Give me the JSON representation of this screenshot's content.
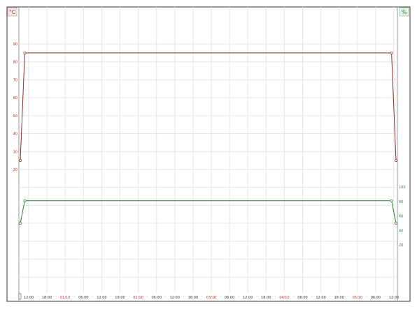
{
  "chart_data": {
    "type": "line",
    "title": "",
    "left_axis": {
      "unit_label": "°C",
      "ticks": [
        "90",
        "80",
        "70",
        "60",
        "50",
        "40",
        "30",
        "20"
      ],
      "ylim": [
        20,
        90
      ]
    },
    "right_axis": {
      "unit_label": "%",
      "ticks": [
        "100",
        "80",
        "60",
        "40",
        "20"
      ],
      "ylim": [
        0,
        100
      ]
    },
    "x_tick_labels": [
      {
        "text": "12:00",
        "kind": "time"
      },
      {
        "text": "18:00",
        "kind": "time"
      },
      {
        "text": "01/10",
        "kind": "date"
      },
      {
        "text": "06:00",
        "kind": "time"
      },
      {
        "text": "12:00",
        "kind": "time"
      },
      {
        "text": "18:00",
        "kind": "time"
      },
      {
        "text": "02/10",
        "kind": "date"
      },
      {
        "text": "06:00",
        "kind": "time"
      },
      {
        "text": "12:00",
        "kind": "time"
      },
      {
        "text": "18:00",
        "kind": "time"
      },
      {
        "text": "03/10",
        "kind": "date"
      },
      {
        "text": "06:00",
        "kind": "time"
      },
      {
        "text": "12:00",
        "kind": "time"
      },
      {
        "text": "18:00",
        "kind": "time"
      },
      {
        "text": "04/10",
        "kind": "date"
      },
      {
        "text": "06:00",
        "kind": "time"
      },
      {
        "text": "12:00",
        "kind": "time"
      },
      {
        "text": "18:00",
        "kind": "time"
      },
      {
        "text": "05/10",
        "kind": "date"
      },
      {
        "text": "06:00",
        "kind": "time"
      },
      {
        "text": "12:00",
        "kind": "time"
      }
    ],
    "xlim": [
      0,
      100
    ],
    "grid": true,
    "series": [
      {
        "axis": "left",
        "color": "#8b2a2a",
        "x": [
          0,
          1.2,
          98.8,
          100
        ],
        "y": [
          25,
          85,
          85,
          25
        ]
      },
      {
        "axis": "right",
        "color": "#2e7d32",
        "x": [
          0,
          1.2,
          98.8,
          100
        ],
        "y": [
          50,
          81,
          81,
          50
        ]
      }
    ],
    "colors": {
      "temperature": "#8b2a2a",
      "humidity": "#2e7d32",
      "grid": "#e6e6e6",
      "frame": "#333333"
    }
  }
}
